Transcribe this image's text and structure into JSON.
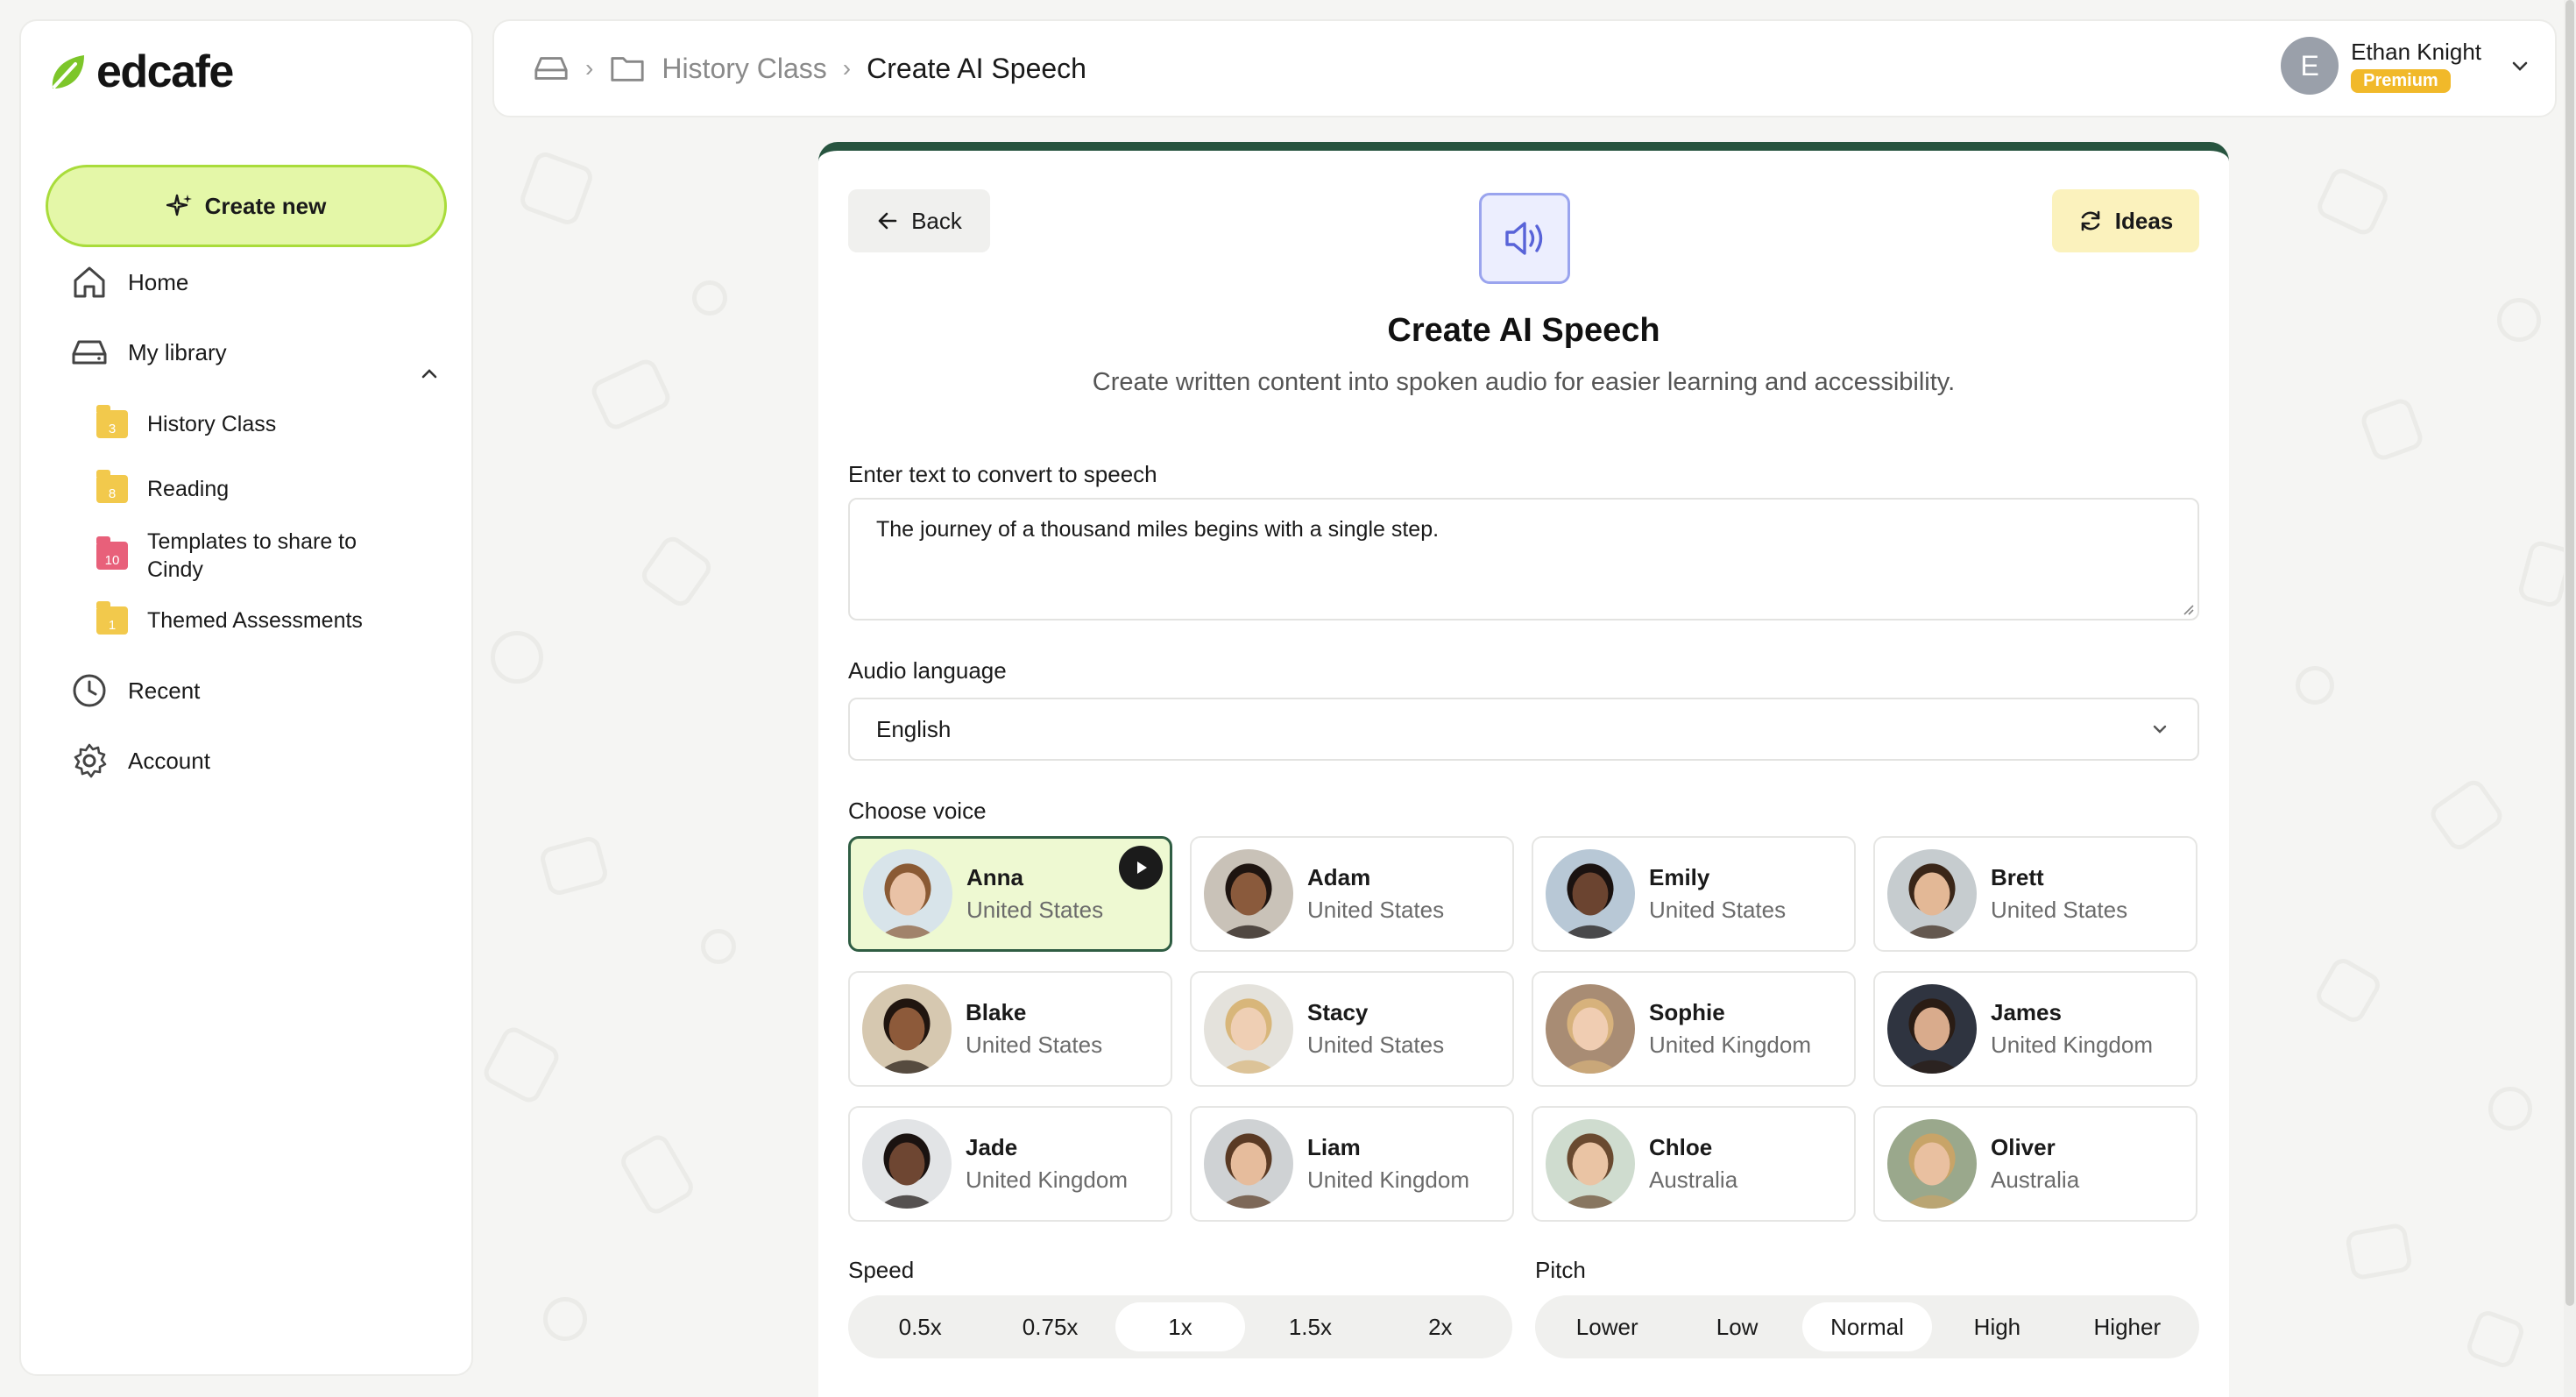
{
  "brand": {
    "name": "edcafe",
    "accent": "#7dc62a"
  },
  "sidebar": {
    "create_label": "Create new",
    "nav": {
      "home": "Home",
      "library": "My library",
      "recent": "Recent",
      "account": "Account"
    },
    "folders": [
      {
        "label": "History Class",
        "count": "3",
        "color": "#f2c94c"
      },
      {
        "label": "Reading",
        "count": "8",
        "color": "#f2c94c"
      },
      {
        "label": "Templates to share to Cindy",
        "count": "10",
        "color": "#e8607a"
      },
      {
        "label": "Themed Assessments",
        "count": "1",
        "color": "#f2c94c"
      }
    ]
  },
  "header": {
    "breadcrumb": {
      "folder": "History Class",
      "current": "Create AI Speech"
    },
    "user": {
      "initial": "E",
      "name": "Ethan Knight",
      "plan": "Premium"
    }
  },
  "main": {
    "back_label": "Back",
    "ideas_label": "Ideas",
    "title": "Create AI Speech",
    "subtitle": "Create written content into spoken audio for easier learning and accessibility.",
    "text_label": "Enter text to convert to speech",
    "text_value": "The journey of a thousand miles begins with a single step.",
    "language_label": "Audio language",
    "language_value": "English",
    "voice_label": "Choose voice",
    "selected_voice": "Anna",
    "voices": [
      {
        "name": "Anna",
        "country": "United States",
        "skin": "#e9c2a6",
        "hair": "#8a5a34",
        "bg": "#d8e4ea"
      },
      {
        "name": "Adam",
        "country": "United States",
        "skin": "#8a5a3c",
        "hair": "#1e1410",
        "bg": "#c9c2b8"
      },
      {
        "name": "Emily",
        "country": "United States",
        "skin": "#6b4430",
        "hair": "#1a1210",
        "bg": "#b8c8d6"
      },
      {
        "name": "Brett",
        "country": "United States",
        "skin": "#e3b896",
        "hair": "#3a2618",
        "bg": "#c6cccf"
      },
      {
        "name": "Blake",
        "country": "United States",
        "skin": "#8d5a3a",
        "hair": "#20150f",
        "bg": "#d6c8b0"
      },
      {
        "name": "Stacy",
        "country": "United States",
        "skin": "#efcfb4",
        "hair": "#d8b67a",
        "bg": "#e4e2dc"
      },
      {
        "name": "Sophie",
        "country": "United Kingdom",
        "skin": "#f0cdb2",
        "hair": "#d7b27c",
        "bg": "#a88c74"
      },
      {
        "name": "James",
        "country": "United Kingdom",
        "skin": "#d9ab8c",
        "hair": "#2a1c14",
        "bg": "#2f3440"
      },
      {
        "name": "Jade",
        "country": "United Kingdom",
        "skin": "#6e4632",
        "hair": "#1a1210",
        "bg": "#e2e4e6"
      },
      {
        "name": "Liam",
        "country": "United Kingdom",
        "skin": "#e6bc9c",
        "hair": "#5a3a24",
        "bg": "#cfd2d4"
      },
      {
        "name": "Chloe",
        "country": "Australia",
        "skin": "#eac4a4",
        "hair": "#6a4a30",
        "bg": "#cfdccf"
      },
      {
        "name": "Oliver",
        "country": "Australia",
        "skin": "#e9c0a0",
        "hair": "#c8a468",
        "bg": "#9aa88c"
      }
    ],
    "speed_label": "Speed",
    "speed_options": [
      "0.5x",
      "0.75x",
      "1x",
      "1.5x",
      "2x"
    ],
    "speed_selected": "1x",
    "pitch_label": "Pitch",
    "pitch_options": [
      "Lower",
      "Low",
      "Normal",
      "High",
      "Higher"
    ],
    "pitch_selected": "Normal"
  }
}
